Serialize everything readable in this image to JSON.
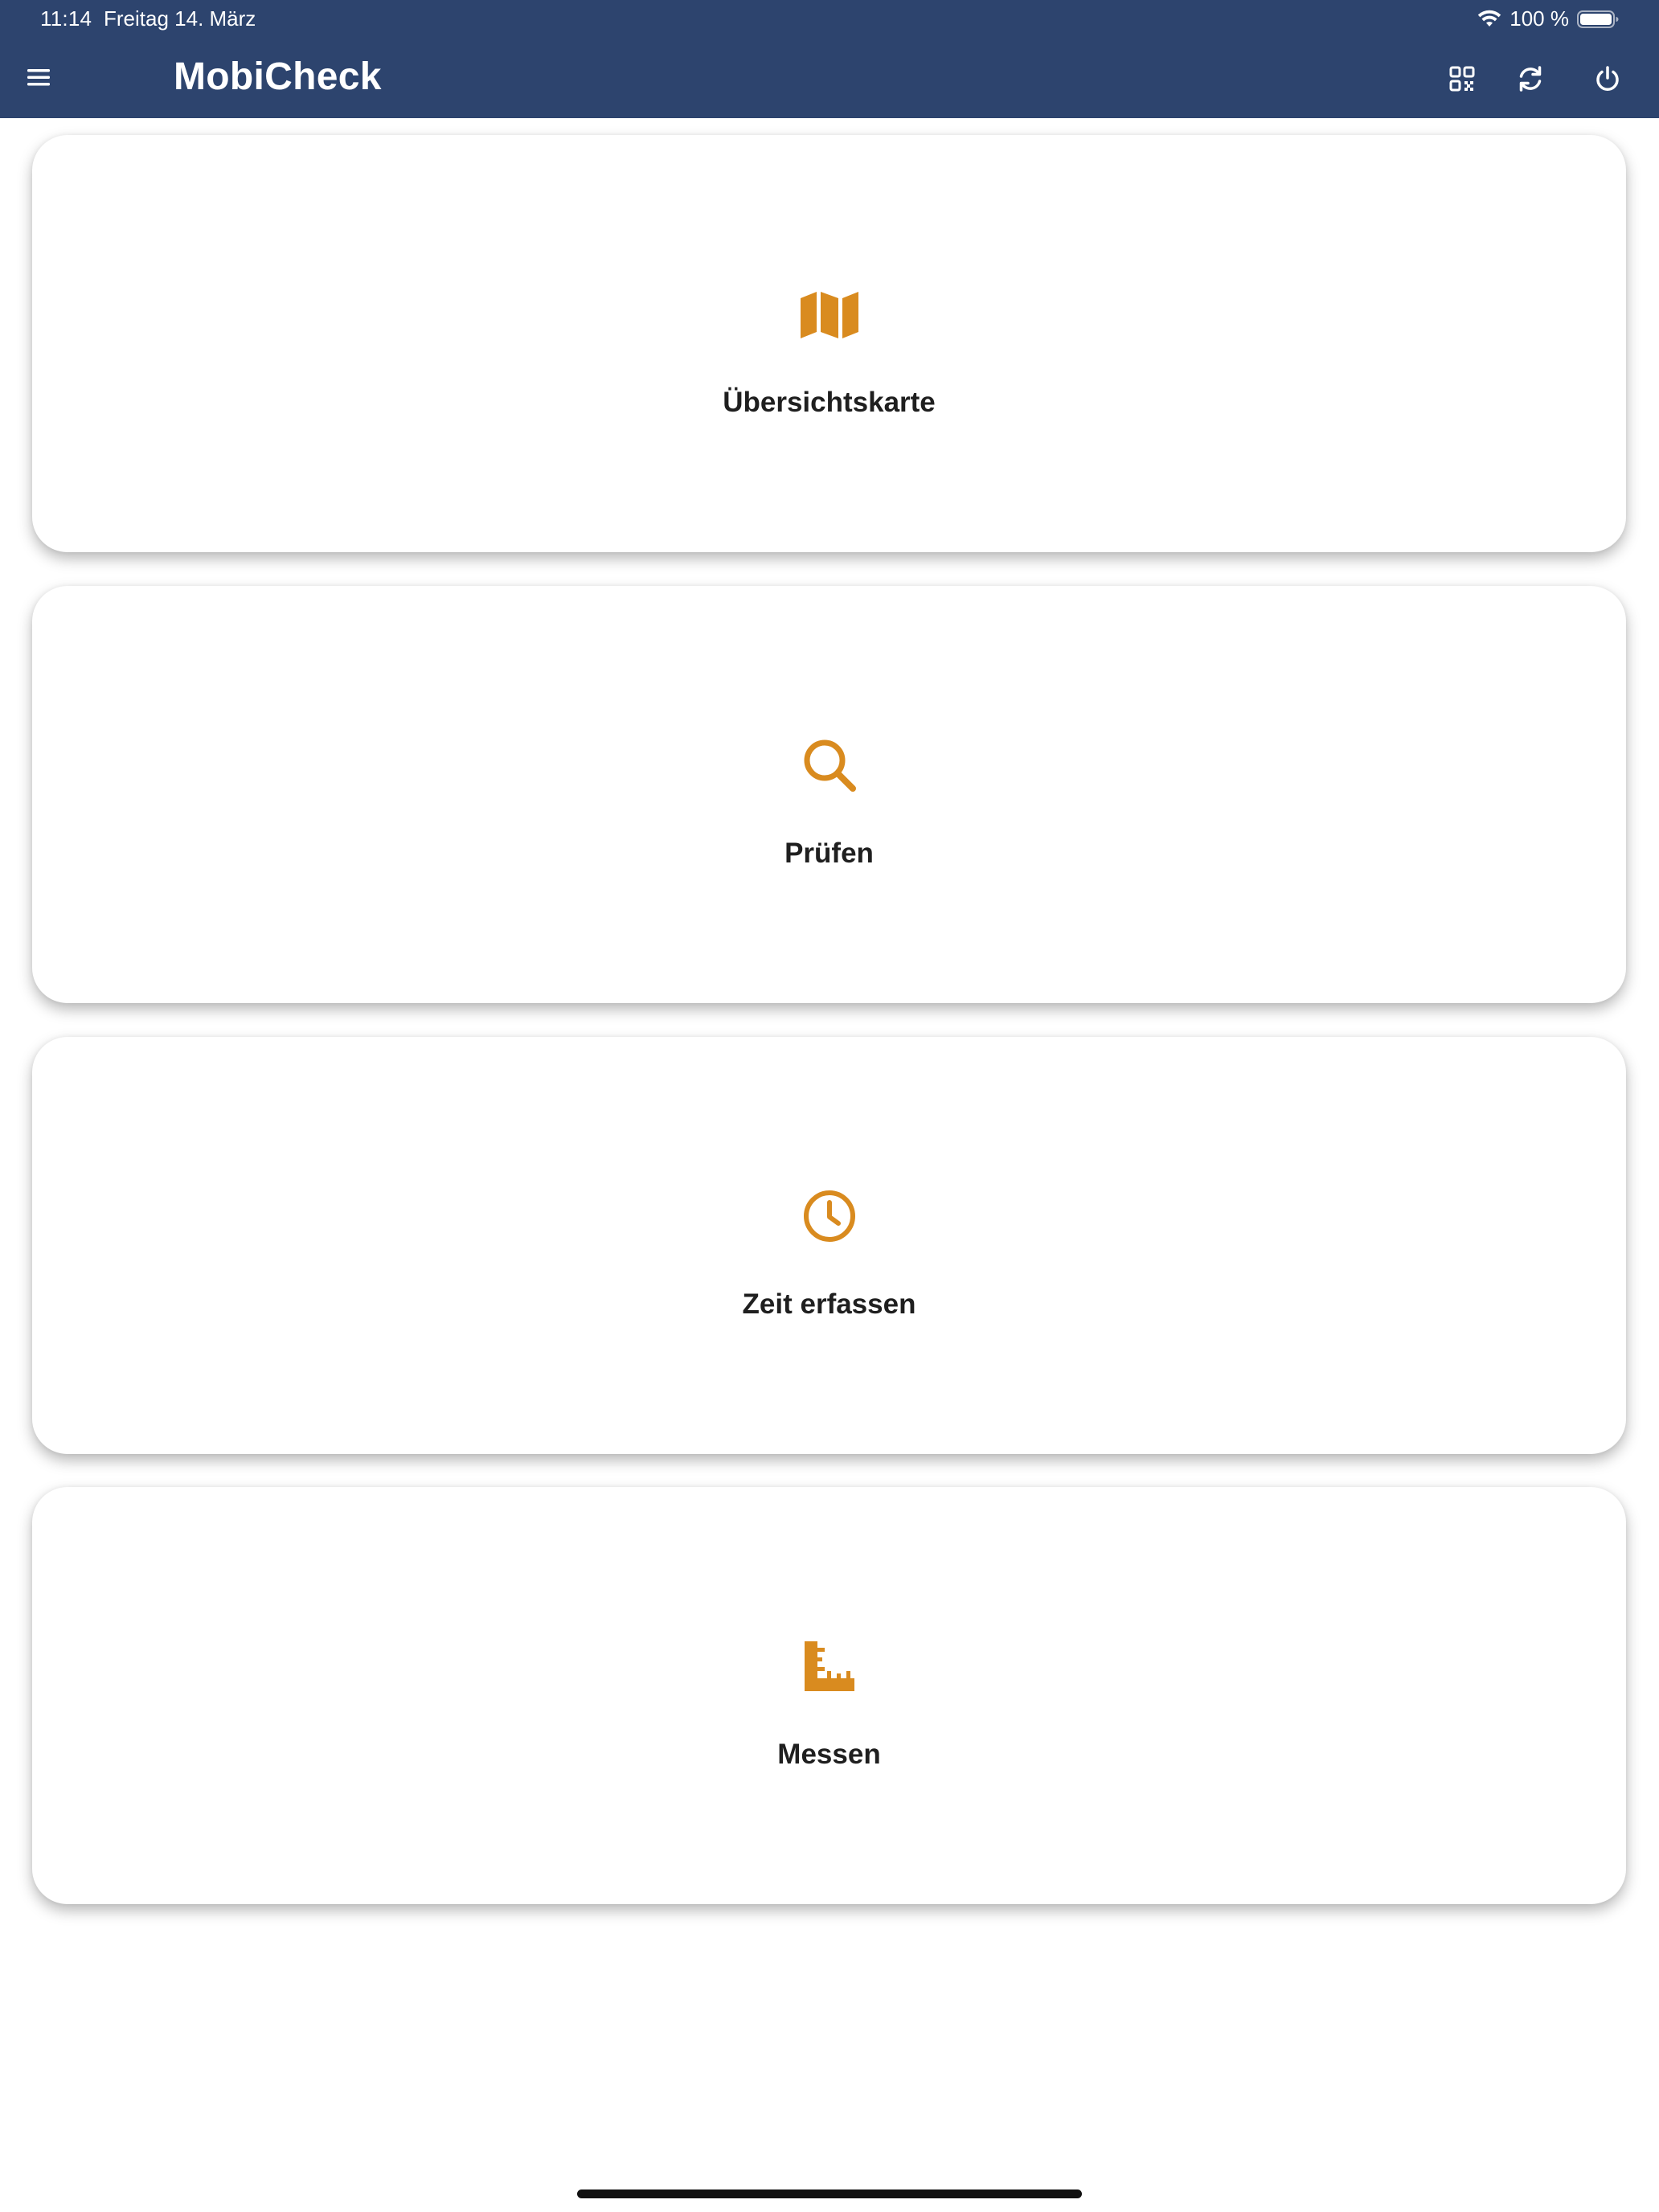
{
  "status_bar": {
    "time": "11:14",
    "date": "Freitag 14. März",
    "battery": "100 %",
    "wifi_icon": "wifi-icon",
    "battery_icon": "battery-icon"
  },
  "header": {
    "title": "MobiCheck",
    "menu_icon": "hamburger-menu-icon",
    "qr_icon": "qr-code-icon",
    "sync_icon": "sync-icon",
    "power_icon": "power-icon"
  },
  "colors": {
    "header_bg": "#2d446e",
    "accent": "#d98b1f",
    "card_text": "#1f1f1f"
  },
  "tiles": [
    {
      "label": "Übersichtskarte",
      "icon": "map-icon"
    },
    {
      "label": "Prüfen",
      "icon": "search-icon"
    },
    {
      "label": "Zeit erfassen",
      "icon": "clock-icon"
    },
    {
      "label": "Messen",
      "icon": "ruler-icon"
    }
  ]
}
